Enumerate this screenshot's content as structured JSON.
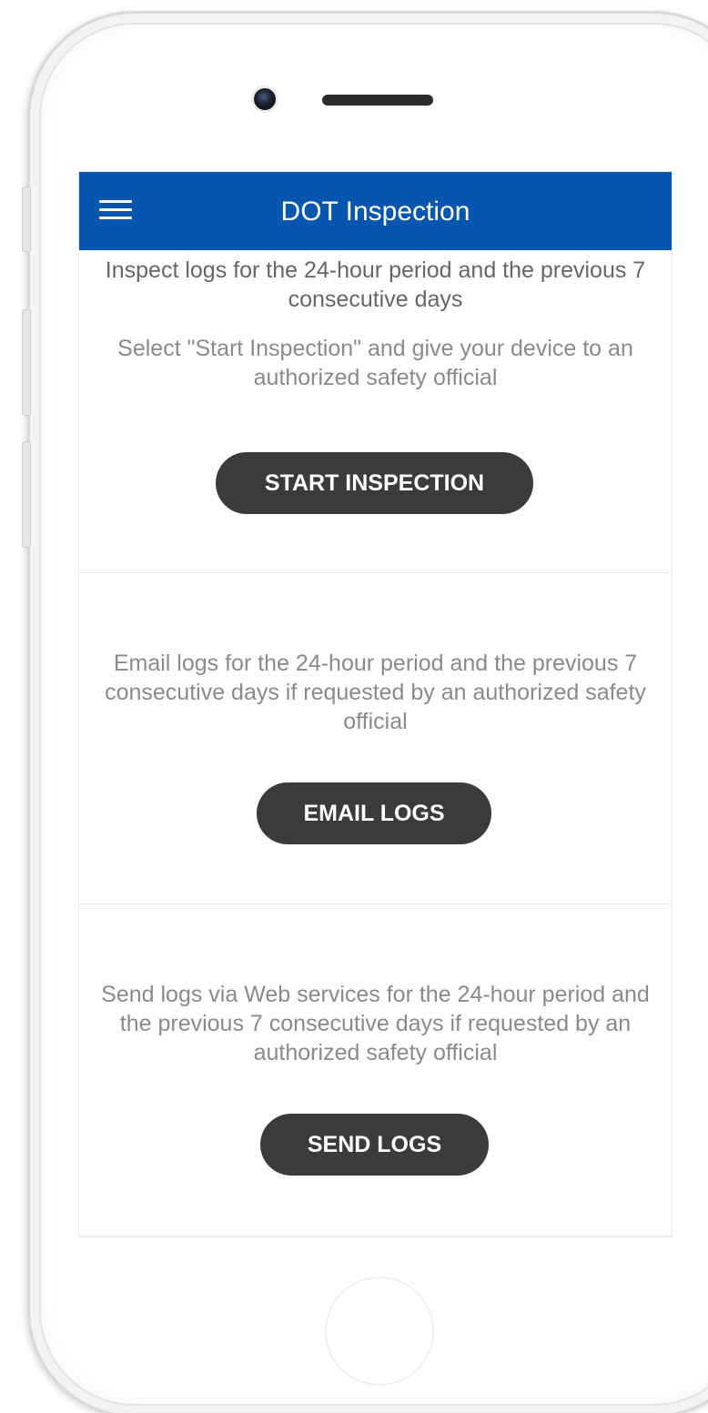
{
  "app_bar": {
    "title": "DOT Inspection",
    "menu_icon": "hamburger-menu-icon",
    "color": "#0655ae"
  },
  "sections": [
    {
      "description_1": "Inspect logs for the 24-hour period and the previous 7 consecutive days",
      "description_2": "Select \"Start Inspection\" and give your device to an authorized safety official",
      "button_label": "START INSPECTION"
    },
    {
      "description": "Email logs for the 24-hour period and the previous 7 consecutive days if requested by an authorized safety official",
      "button_label": "EMAIL LOGS"
    },
    {
      "description": "Send logs via Web services for the 24-hour period and the previous 7 consecutive days if requested by an authorized safety official",
      "button_label": "SEND LOGS"
    }
  ],
  "colors": {
    "button": "#3b3b3b",
    "text": "#8a8a8a"
  }
}
